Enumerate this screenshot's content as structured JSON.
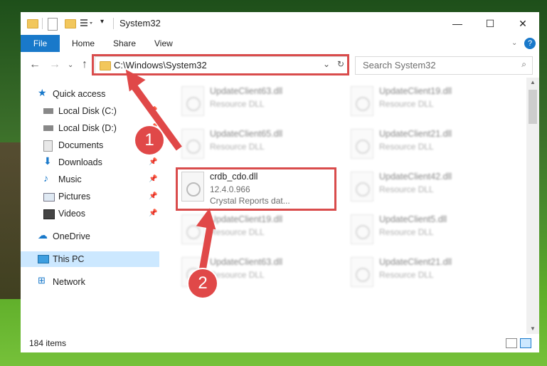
{
  "window": {
    "title": "System32",
    "min": "—",
    "max": "☐",
    "close": "✕"
  },
  "ribbon": {
    "file": "File",
    "tabs": [
      "Home",
      "Share",
      "View"
    ]
  },
  "address": {
    "path": "C:\\Windows\\System32"
  },
  "search": {
    "placeholder": "Search System32"
  },
  "sidebar": {
    "items": [
      {
        "label": "Quick access",
        "icon": "star-icon"
      },
      {
        "label": "Local Disk (C:)",
        "icon": "drive-icon"
      },
      {
        "label": "Local Disk (D:)",
        "icon": "drive-icon"
      },
      {
        "label": "Documents",
        "icon": "documents-icon"
      },
      {
        "label": "Downloads",
        "icon": "download-icon"
      },
      {
        "label": "Music",
        "icon": "music-icon"
      },
      {
        "label": "Pictures",
        "icon": "pictures-icon"
      },
      {
        "label": "Videos",
        "icon": "videos-icon"
      },
      {
        "label": "OneDrive",
        "icon": "cloud-icon"
      },
      {
        "label": "This PC",
        "icon": "computer-icon"
      },
      {
        "label": "Network",
        "icon": "network-icon"
      }
    ]
  },
  "files": {
    "focused": {
      "name": "crdb_cdo.dll",
      "version": "12.4.0.966",
      "desc": "Crystal Reports dat..."
    },
    "left": [
      {
        "name": "UpdateClient63.dll",
        "type": "Resource DLL"
      },
      {
        "name": "UpdateClient65.dll",
        "type": "Resource DLL"
      },
      {
        "name": "UpdateClient19.dll",
        "type": "Resource DLL"
      },
      {
        "name": "UpdateClient63.dll",
        "type": "Resource DLL"
      }
    ],
    "right": [
      {
        "name": "UpdateClient19.dll",
        "type": "Resource DLL"
      },
      {
        "name": "UpdateClient21.dll",
        "type": "Resource DLL"
      },
      {
        "name": "UpdateClient42.dll",
        "type": "Resource DLL"
      },
      {
        "name": "UpdateClient5.dll",
        "type": "Resource DLL"
      },
      {
        "name": "UpdateClient21.dll",
        "type": "Resource DLL"
      }
    ]
  },
  "status": {
    "count": "184 items"
  },
  "annotations": {
    "badge1": "1",
    "badge2": "2"
  },
  "colors": {
    "accent": "#1979ca",
    "highlight": "#d94c4c",
    "selection": "#cce8ff"
  }
}
